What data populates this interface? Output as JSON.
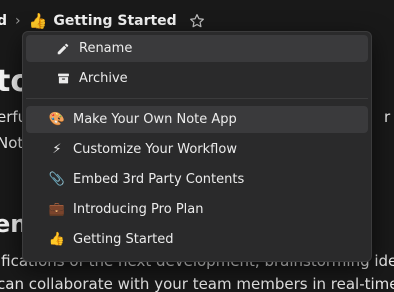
{
  "breadcrumb": {
    "previous_fragment": "d",
    "separator": "›",
    "current_emoji": "👍",
    "current_title": "Getting Started"
  },
  "background": {
    "title_fragment": "to",
    "line1_left": "erfu",
    "line1_right": "r",
    "line2_left": "Note",
    "heading_fragment": "en",
    "line3": "ifications of the next development, brainstorming ideas fo",
    "line4": "can collaborate with your team members in real-time, and"
  },
  "menu": {
    "actions": [
      {
        "icon": "pencil-icon",
        "glyph": "✏",
        "label": "Rename"
      },
      {
        "icon": "archive-box-icon",
        "glyph": "🗃",
        "label": "Archive"
      }
    ],
    "pages": [
      {
        "emoji": "🎨",
        "label": "Make Your Own Note App"
      },
      {
        "emoji": "⚡",
        "label": "Customize Your Workflow"
      },
      {
        "emoji": "📎",
        "label": "Embed 3rd Party Contents"
      },
      {
        "emoji": "💼",
        "label": "Introducing Pro Plan"
      },
      {
        "emoji": "👍",
        "label": "Getting Started"
      }
    ]
  }
}
